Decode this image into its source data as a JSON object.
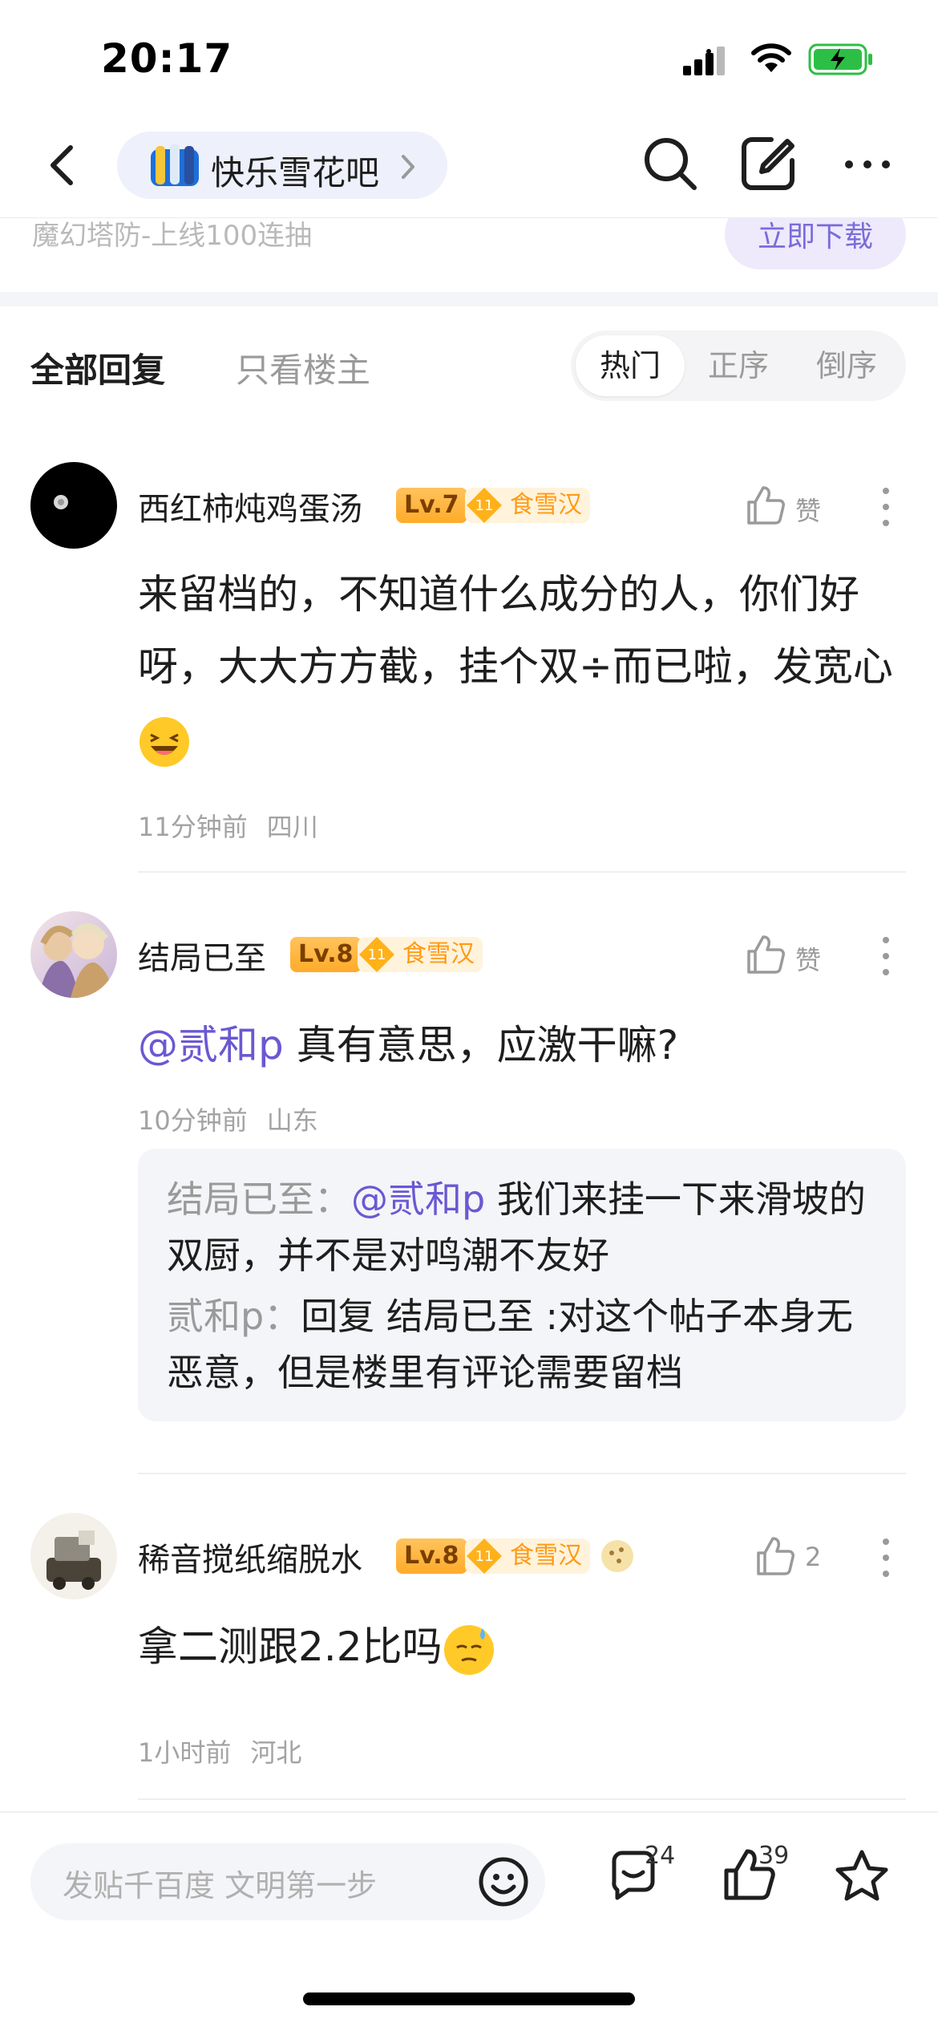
{
  "status_bar": {
    "time": "20:17"
  },
  "nav": {
    "forum_name": "快乐雪花吧"
  },
  "ad": {
    "text": "魔幻塔防-上线100连抽",
    "button": "立即下载"
  },
  "filter": {
    "tabs": [
      "全部回复",
      "只看楼主"
    ],
    "sort": [
      "热门",
      "正序",
      "倒序"
    ],
    "active_sort": "热门"
  },
  "comments": [
    {
      "name": "西红柿炖鸡蛋汤",
      "level": "Lv.7",
      "title_num": "11",
      "title": "食雪汉",
      "like_label": "赞",
      "text": "来留档的，不知道什么成分的人，你们好呀，大大方方截，挂个双÷而已啦，发宽心",
      "time": "11分钟前",
      "location": "四川"
    },
    {
      "name": "结局已至",
      "level": "Lv.8",
      "title_num": "11",
      "title": "食雪汉",
      "like_label": "赞",
      "mention": "@贰和p",
      "text": " 真有意思，应激干嘛?",
      "time": "10分钟前",
      "location": "山东",
      "replies": [
        {
          "user": "结局已至：",
          "mention": "@贰和p",
          "text": " 我们来挂一下来滑坡的双厨，并不是对鸣潮不友好"
        },
        {
          "user": "贰和p：",
          "text": "回复 结局已至 :对这个帖子本身无恶意，但是楼里有评论需要留档"
        }
      ]
    },
    {
      "name": "稀音搅纸缩脱水",
      "level": "Lv.8",
      "title_num": "11",
      "title": "食雪汉",
      "like_label": "2",
      "text": "拿二测跟2.2比吗",
      "time": "1小时前",
      "location": "河北"
    }
  ],
  "bottom_bar": {
    "placeholder": "发贴千百度 文明第一步",
    "comment_count": "24",
    "like_count": "39"
  },
  "colors": {
    "accent": "#6a58d3",
    "badge": "#ffab2a",
    "title_text": "#ff9a14"
  }
}
